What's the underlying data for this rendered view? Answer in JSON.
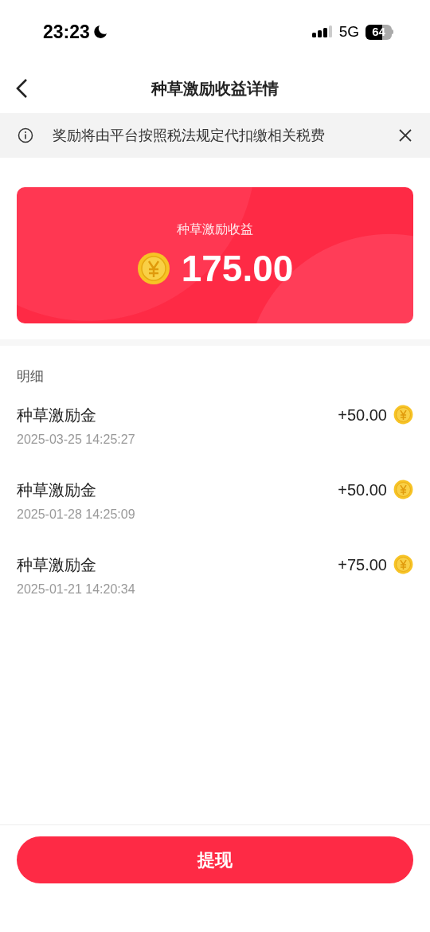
{
  "status_bar": {
    "time": "23:23",
    "network": "5G",
    "battery": "64"
  },
  "nav": {
    "title": "种草激励收益详情"
  },
  "notice": {
    "text": "奖励将由平台按照税法规定代扣缴相关税费"
  },
  "summary": {
    "label": "种草激励收益",
    "amount": "175.00"
  },
  "details": {
    "heading": "明细",
    "rows": [
      {
        "title": "种草激励金",
        "time": "2025-03-25 14:25:27",
        "amount": "+50.00"
      },
      {
        "title": "种草激励金",
        "time": "2025-01-28 14:25:09",
        "amount": "+50.00"
      },
      {
        "title": "种草激励金",
        "time": "2025-01-21 14:20:34",
        "amount": "+75.00"
      }
    ]
  },
  "button": {
    "label": "提现"
  }
}
